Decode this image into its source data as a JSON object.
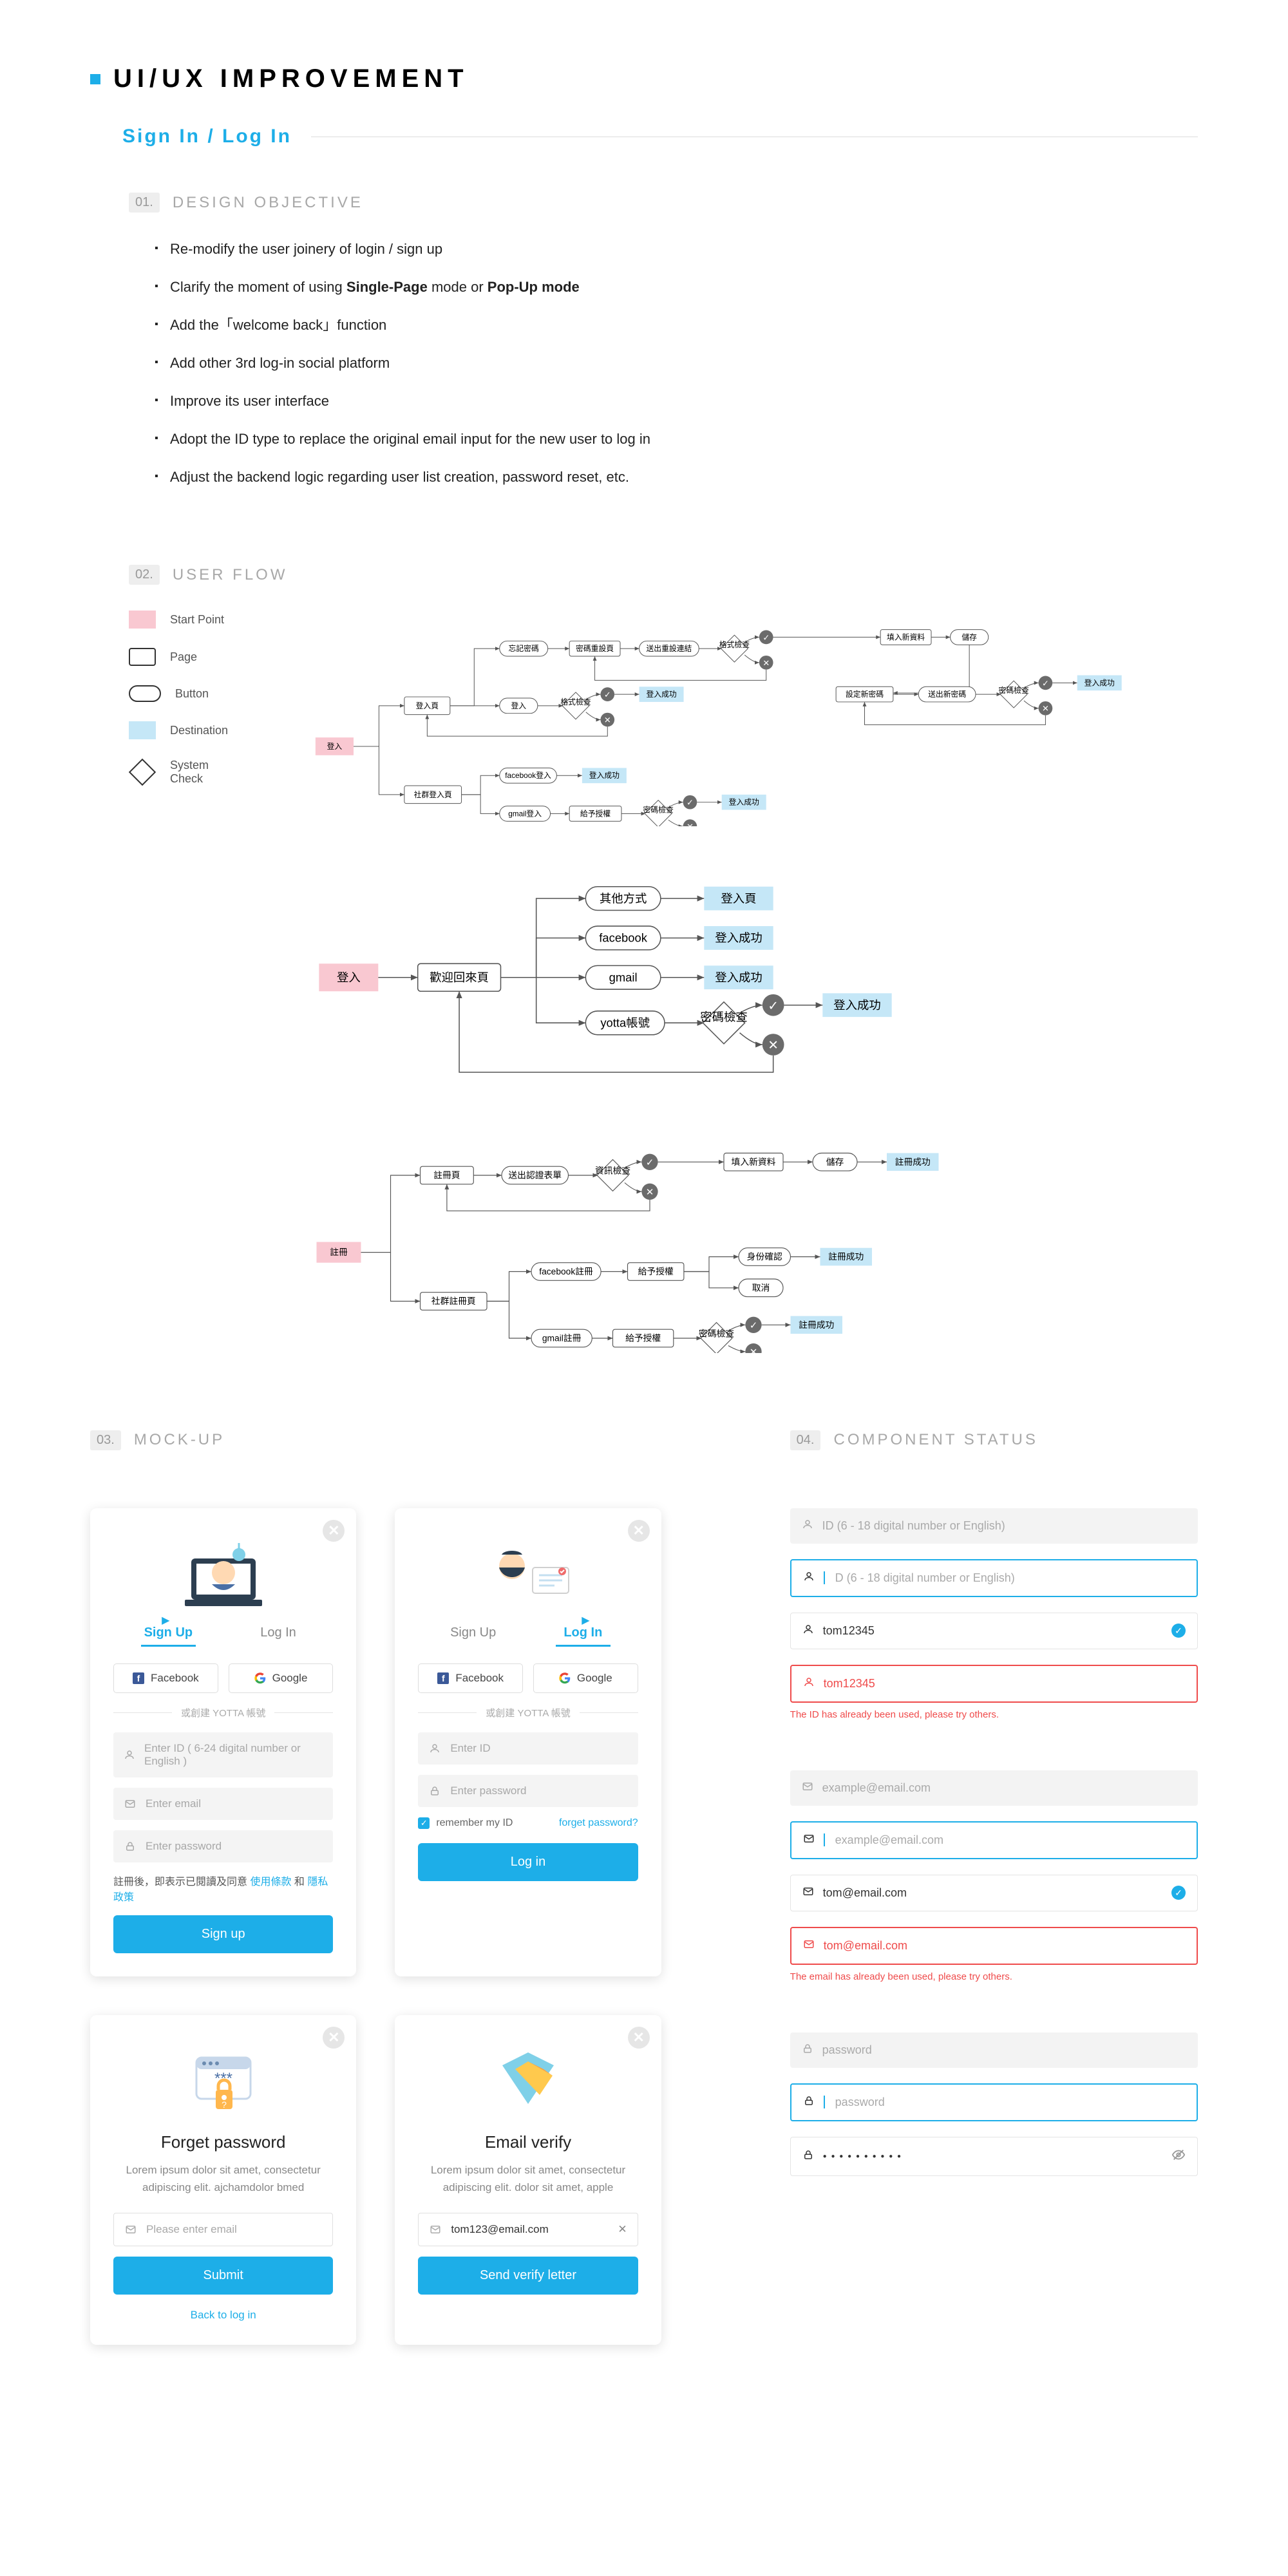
{
  "pageTitle": "UI/UX IMPROVEMENT",
  "subtitle": "Sign In / Log In",
  "sections": {
    "objective": {
      "num": "01.",
      "title": "DESIGN OBJECTIVE"
    },
    "userflow": {
      "num": "02.",
      "title": "USER FLOW"
    },
    "mockup": {
      "num": "03.",
      "title": "MOCK-UP"
    },
    "component": {
      "num": "04.",
      "title": "COMPONENT STATUS"
    }
  },
  "objectives": [
    {
      "text": "Re-modify the user joinery of login / sign up"
    },
    {
      "html": "Clarify the moment of using <strong>Single-Page</strong> mode or <strong>Pop-Up mode</strong>"
    },
    {
      "text": "Add the「welcome back」function"
    },
    {
      "text": "Add other 3rd log-in social platform"
    },
    {
      "text": "Improve its user interface"
    },
    {
      "text": "Adopt the ID type to replace the original email input for the new user to log in"
    },
    {
      "text": "Adjust the backend logic regarding user list creation, password reset, etc."
    }
  ],
  "legend": {
    "start": "Start Point",
    "page": "Page",
    "button": "Button",
    "destination": "Destination",
    "system": "System\nCheck"
  },
  "flow": {
    "start_login": "登入",
    "start_signup": "註冊",
    "login_page": "登入頁",
    "social_login_page": "社群登入頁",
    "signup_page": "註冊頁",
    "social_signup_page": "社群註冊頁",
    "welcome_back": "歡迎回來頁",
    "forgot_pwd": "忘記密碼",
    "forgot_pwd_page": "密碼重設頁",
    "send_reset_link": "送出重設連結",
    "format_check": "格式檢查",
    "pwd_check": "密碼檢查",
    "info_check": "資訊檢查",
    "id_check": "身份確認",
    "login_btn": "登入",
    "login_success": "登入成功",
    "facebook_login": "facebook登入",
    "gmail_login": "gmail登入",
    "grant_auth": "給予授權",
    "fill_info": "填入新資料",
    "set_new_pwd": "設定新密碼",
    "send_new_pwd": "送出新密碼",
    "save": "儲存",
    "other_method": "其他方式",
    "facebook": "facebook",
    "gmail": "gmail",
    "yotta_account": "yotta帳號",
    "login_page2": "登入頁",
    "signup_btn": "註冊",
    "send_verify": "送出認證表單",
    "facebook_signup": "facebook註冊",
    "gmail_signup": "gmail註冊",
    "signup_success": "註冊成功",
    "cancel": "取消"
  },
  "mock": {
    "signup": {
      "tab_signup": "Sign Up",
      "tab_login": "Log In",
      "facebook": "Facebook",
      "google": "Google",
      "or_text": "或創建 YOTTA 帳號",
      "id_ph": "Enter ID ( 6-24 digital number or English )",
      "email_ph": "Enter email",
      "pwd_ph": "Enter password",
      "consent_pre": "註冊後，即表示已閱讀及同意 ",
      "terms": "使用條款",
      "and": " 和 ",
      "privacy": "隱私政策",
      "btn": "Sign up"
    },
    "login": {
      "tab_signup": "Sign Up",
      "tab_login": "Log In",
      "facebook": "Facebook",
      "google": "Google",
      "or_text": "或創建 YOTTA 帳號",
      "id_ph": "Enter ID",
      "pwd_ph": "Enter password",
      "remember": "remember my ID",
      "forget": "forget password?",
      "btn": "Log in"
    },
    "forget": {
      "title": "Forget password",
      "desc": "Lorem ipsum dolor sit amet, consectetur adipiscing elit. ajchamdolor bmed",
      "email_ph": "Please enter email",
      "btn": "Submit",
      "back": "Back to log in"
    },
    "verify": {
      "title": "Email verify",
      "desc": "Lorem ipsum dolor sit amet, consectetur adipiscing elit. dolor sit amet, apple",
      "email_val": "tom123@email.com",
      "btn": "Send verify letter"
    }
  },
  "status": {
    "id_ph": "ID (6 - 18 digital number or English)",
    "id_focus": "D (6 - 18 digital number or English)",
    "id_valid": "tom12345",
    "id_err": "tom12345",
    "id_err_msg": "The ID has already been used, please try others.",
    "email_ph": "example@email.com",
    "email_focus": "example@email.com",
    "email_valid": "tom@email.com",
    "email_err": "tom@email.com",
    "email_err_msg": "The email has already been used, please try others.",
    "pwd_ph": "password",
    "pwd_focus": "password",
    "pwd_dots": "● ● ● ● ● ● ● ● ● ●"
  }
}
